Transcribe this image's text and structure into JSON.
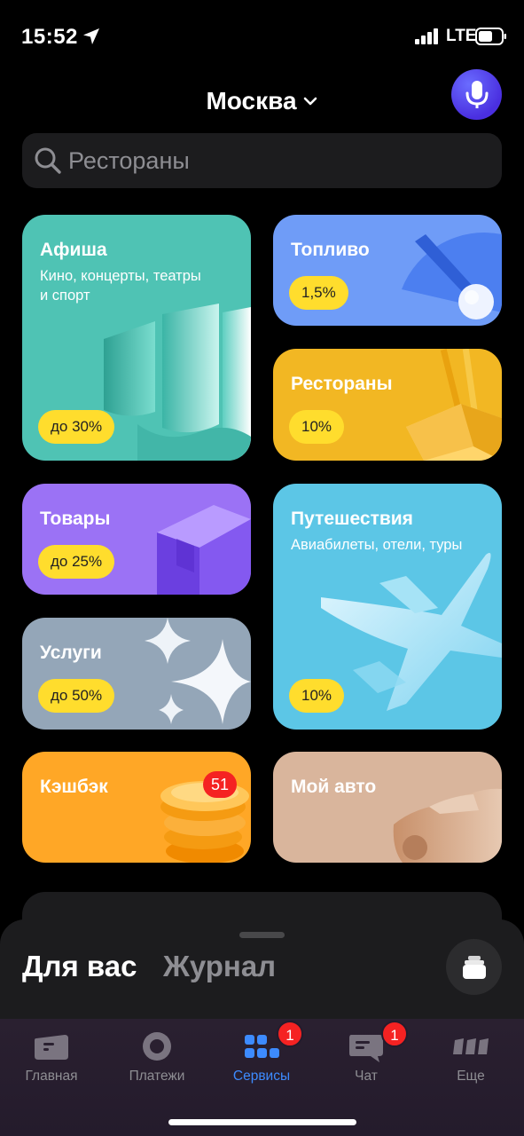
{
  "status": {
    "time": "15:52",
    "network": "LTE"
  },
  "header": {
    "city": "Москва"
  },
  "search": {
    "placeholder": "Рестораны"
  },
  "cards": {
    "afisha": {
      "title": "Афиша",
      "subtitle_line1": "Кино, концерты, театры",
      "subtitle_line2": "и спорт",
      "badge": "до 30%"
    },
    "fuel": {
      "title": "Топливо",
      "badge": "1,5%"
    },
    "restaurants": {
      "title": "Рестораны",
      "badge": "10%"
    },
    "goods": {
      "title": "Товары",
      "badge": "до 25%"
    },
    "travel": {
      "title": "Путешествия",
      "subtitle": "Авиабилеты, отели, туры",
      "badge": "10%"
    },
    "services": {
      "title": "Услуги",
      "badge": "до 50%"
    },
    "cashback": {
      "title": "Кэшбэк",
      "count": "51"
    },
    "my_car": {
      "title": "Мой авто"
    }
  },
  "sheet": {
    "tab_for_you": "Для вас",
    "tab_journal": "Журнал"
  },
  "tabbar": {
    "items": [
      {
        "label": "Главная",
        "badge": ""
      },
      {
        "label": "Платежи",
        "badge": ""
      },
      {
        "label": "Сервисы",
        "badge": "1"
      },
      {
        "label": "Чат",
        "badge": "1"
      },
      {
        "label": "Еще",
        "badge": ""
      }
    ]
  },
  "colors": {
    "accent": "#3d8bff",
    "badge_yellow": "#ffdd2d",
    "afisha": "#4fc3b4",
    "fuel": "#6f9cf7",
    "restaurants": "#f2b723",
    "goods": "#9b72f5",
    "travel": "#5cc6e6",
    "services": "#94a6b8",
    "cashback": "#ffa726",
    "my_car": "#d9b59c"
  }
}
